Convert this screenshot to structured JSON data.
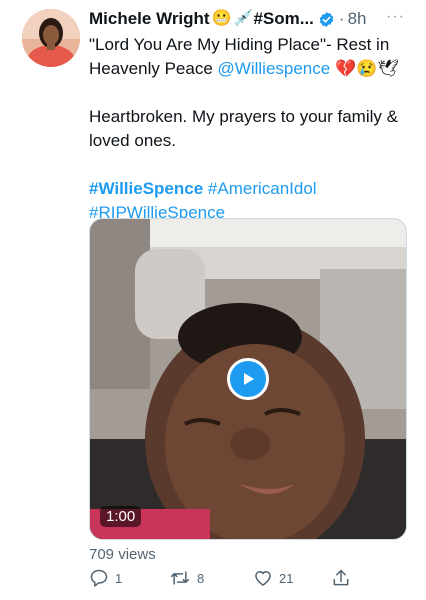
{
  "author": {
    "name": "Michele Wright",
    "display_suffix": "#Som...",
    "time": "8h",
    "verified": true
  },
  "tweet": {
    "line1_text": "\"Lord You Are My Hiding Place\"- Rest in Heavenly Peace ",
    "mention": "@Williespence",
    "line1_emojis": "💔😢🕊",
    "line2": "Heartbroken. My prayers to your family & loved ones.",
    "hashtag1": "#WillieSpence",
    "hashtag2": "#AmericanIdol",
    "hashtag3": "#RIPWillieSpence"
  },
  "media": {
    "duration": "1:00",
    "views": "709 views"
  },
  "actions": {
    "reply_count": "1",
    "retweet_count": "8",
    "like_count": "21"
  },
  "icons": {
    "verified": "verified-badge-icon",
    "play": "play-icon",
    "reply": "reply-icon",
    "retweet": "retweet-icon",
    "like": "heart-icon",
    "share": "share-icon",
    "more": "more-icon"
  },
  "colors": {
    "accent": "#1d9bf0",
    "muted": "#536471"
  }
}
